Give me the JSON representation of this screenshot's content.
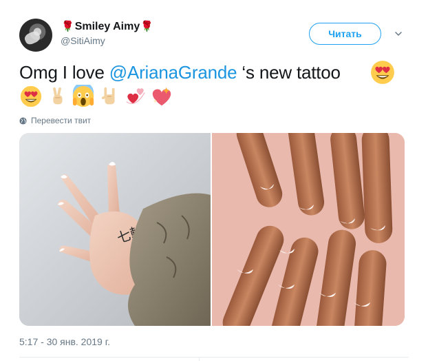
{
  "user": {
    "display_name": "Smiley Aimy",
    "name_emoji": "🌹",
    "handle": "@SitiAimy"
  },
  "follow_button": {
    "label": "Читать"
  },
  "tweet": {
    "text_before": "Omg I love ",
    "mention": "@ArianaGrande",
    "text_after": " ‘s new tattoo"
  },
  "translate": {
    "label": "Перевести твит"
  },
  "timestamp": "5:17 - 30 янв. 2019 г.",
  "icons": {
    "emoji_inline": "heart-eyes-emoji",
    "emoji_row": [
      "heart-eyes-emoji",
      "victory-hand-emoji",
      "scream-emoji",
      "rock-hand-emoji",
      "revolving-hearts-emoji",
      "sparkling-heart-emoji"
    ]
  },
  "colors": {
    "accent": "#1da1f2",
    "mention": "#1b95e0",
    "muted": "#657786"
  }
}
